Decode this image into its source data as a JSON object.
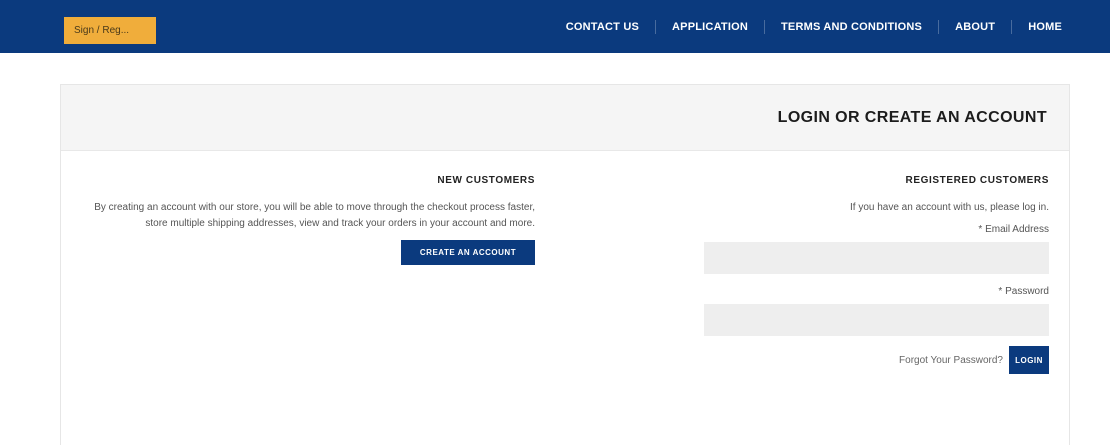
{
  "header": {
    "brand_label": "Sign / Reg...",
    "nav": [
      {
        "label": "CONTACT US"
      },
      {
        "label": "APPLICATION"
      },
      {
        "label": "TERMS AND CONDITIONS"
      },
      {
        "label": "ABOUT"
      },
      {
        "label": "HOME"
      }
    ]
  },
  "page": {
    "title": "LOGIN OR CREATE AN ACCOUNT"
  },
  "new_customers": {
    "heading": "NEW CUSTOMERS",
    "text": "By creating an account with our store, you will be able to move through the checkout process faster, store multiple shipping addresses, view and track your orders in your account and more.",
    "button": "CREATE AN ACCOUNT"
  },
  "registered": {
    "heading": "REGISTERED CUSTOMERS",
    "intro": "If you have an account with us, please log in.",
    "email_label": "* Email Address",
    "email_value": "",
    "email_placeholder": "",
    "password_label": "* Password",
    "password_value": "",
    "password_placeholder": "",
    "forgot": "Forgot Your Password?",
    "login_button": "LOGIN"
  },
  "colors": {
    "navy": "#0b3a7e",
    "accent": "#f0ad3b",
    "panel_bg": "#f5f5f5",
    "input_bg": "#eeeeee"
  }
}
